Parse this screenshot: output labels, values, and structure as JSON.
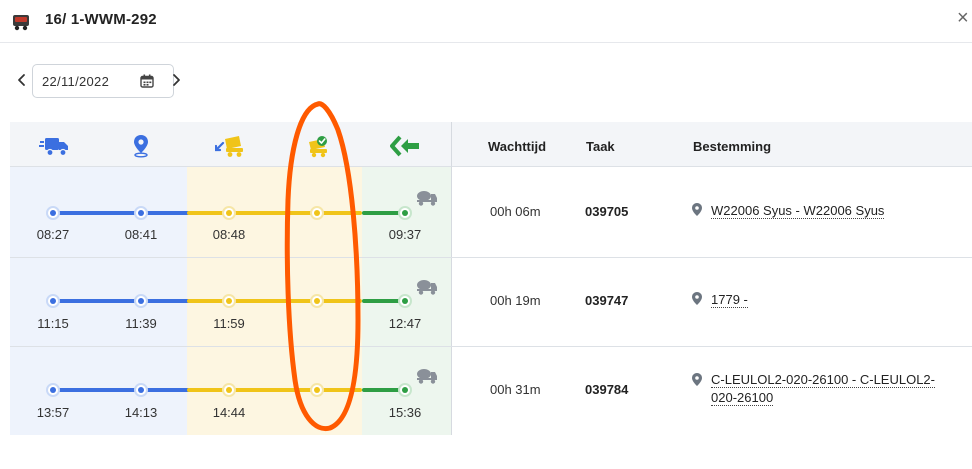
{
  "window": {
    "title": "16/ 1-WWM-292",
    "close_label": "×"
  },
  "date_picker": {
    "value": "22/11/2022"
  },
  "columns": {
    "stage_icons": [
      "truck-icon",
      "location-pin-icon",
      "mixer-loading-icon",
      "mixer-check-icon",
      "back-arrow-icon"
    ],
    "headers": {
      "wait": "Wachttijd",
      "task": "Taak",
      "destination": "Bestemming"
    }
  },
  "rows": [
    {
      "times": [
        "08:27",
        "08:41",
        "08:48",
        "09:37"
      ],
      "wait": "00h 06m",
      "task": "039705",
      "destination": "W22006 Syus - W22006 Syus"
    },
    {
      "times": [
        "11:15",
        "11:39",
        "11:59",
        "12:47"
      ],
      "wait": "00h 19m",
      "task": "039747",
      "destination": "1779 -"
    },
    {
      "times": [
        "13:57",
        "14:13",
        "14:44",
        "15:36"
      ],
      "wait": "00h 31m",
      "task": "039784",
      "destination_lines": [
        "C-LEULOL2-020-26100 - C-LEULOL2-",
        "020-26100"
      ]
    }
  ],
  "colors": {
    "blue": "#3b6fe0",
    "yellow": "#f0c419",
    "green": "#2e9e44",
    "annotation": "#ff5a00"
  }
}
